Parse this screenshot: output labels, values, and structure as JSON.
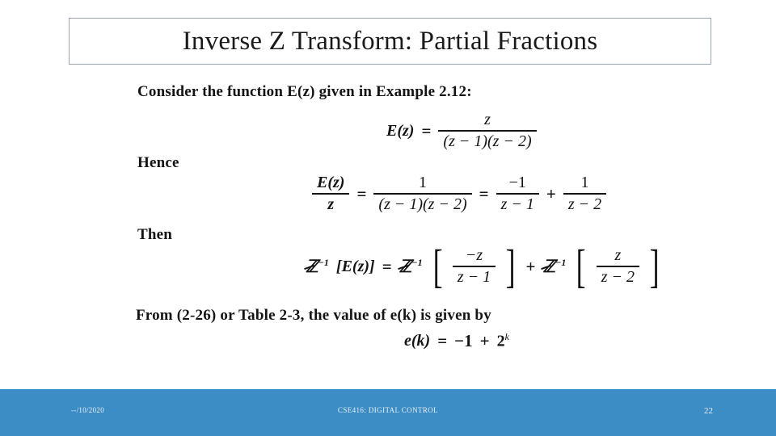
{
  "slide": {
    "title": "Inverse Z Transform: Partial Fractions",
    "body": {
      "lead_1": "Consider the function E(z) given in Example 2.12:",
      "eq1": {
        "lhs": "E(z)",
        "equals": "=",
        "num": "z",
        "den": "(z − 1)(z − 2)"
      },
      "lead_2": "Hence",
      "eq2": {
        "lhs_num": "E(z)",
        "lhs_den": "z",
        "equals_1": "=",
        "mid_num": "1",
        "mid_den": "(z − 1)(z − 2)",
        "equals_2": "=",
        "t1_num": "−1",
        "t1_den": "z − 1",
        "plus": "+",
        "t2_num": "1",
        "t2_den": "z − 2"
      },
      "lead_3": "Then",
      "eq3": {
        "lhs_op": "ℤ",
        "lhs_sup": "−1",
        "lhs_arg": "[E(z)]",
        "equals": "=",
        "op2": "ℤ",
        "op2_sup": "−1",
        "t1_num": "−z",
        "t1_den": "z − 1",
        "plus": "+",
        "op3": "ℤ",
        "op3_sup": "−1",
        "t2_num": "z",
        "t2_den": "z − 2"
      },
      "lead_4": "From (2-26) or Table 2-3, the value of e(k) is given by",
      "eq4": {
        "lhs": "e(k)",
        "equals": "=",
        "rhs_a": "−1",
        "plus": "+",
        "rhs_b": "2",
        "rhs_b_sup": "k"
      }
    }
  },
  "footer": {
    "date": "--/10/2020",
    "center": "CSE416: DIGITAL CONTROL",
    "page": "22",
    "bar_color": "#3c8dc5"
  }
}
